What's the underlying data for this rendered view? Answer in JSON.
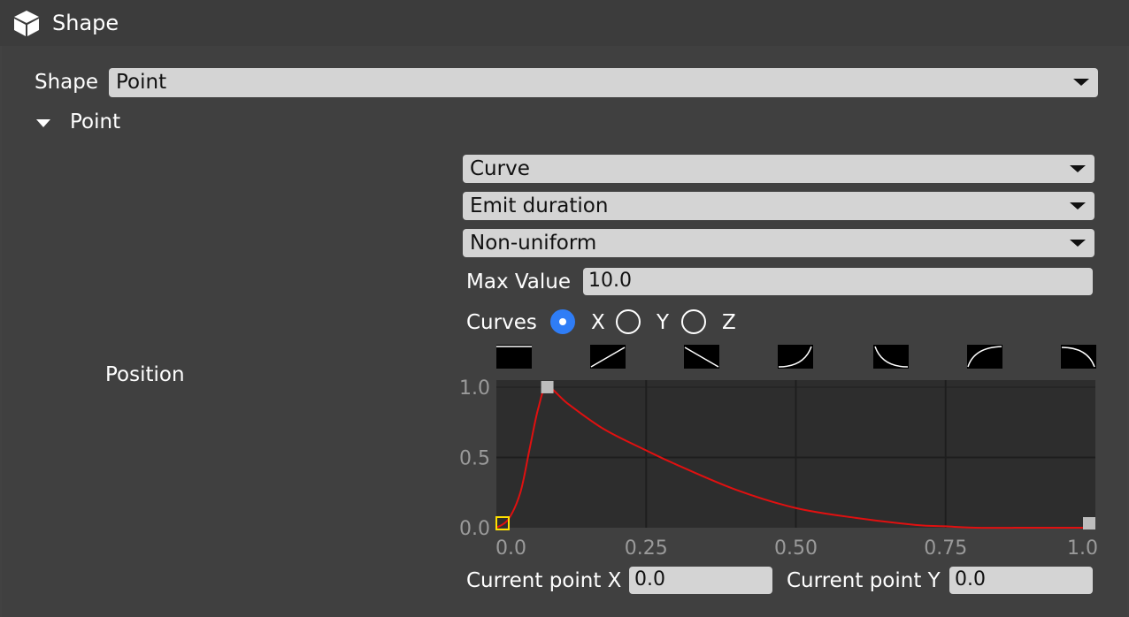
{
  "header": {
    "title": "Shape",
    "icon": "cube-icon"
  },
  "shape": {
    "label": "Shape",
    "value": "Point"
  },
  "section": {
    "label": "Point",
    "expanded": true
  },
  "position": {
    "label": "Position",
    "mode": "Curve",
    "curve_source": "Emit duration",
    "uniformity": "Non-uniform",
    "max_value_label": "Max Value",
    "max_value": "10.0",
    "curves_label": "Curves",
    "curve_options": [
      {
        "label": "X",
        "checked": true
      },
      {
        "label": "Y",
        "checked": false
      },
      {
        "label": "Z",
        "checked": false
      }
    ],
    "presets": [
      "constant",
      "linear-up",
      "linear-down",
      "ease-in",
      "ease-out-down",
      "ease-out-up",
      "ease-in-down"
    ],
    "current_x_label": "Current point X",
    "current_x": "0.0",
    "current_y_label": "Current point Y",
    "current_y": "0.0"
  },
  "colors": {
    "accent": "#2f7df6",
    "curve": "#e01010",
    "selected_point": "#ffe000"
  },
  "chart_data": {
    "type": "line",
    "x_ticks": [
      "0.0",
      "0.25",
      "0.50",
      "0.75",
      "1.0"
    ],
    "y_ticks": [
      "1.0",
      "0.5",
      "0.0"
    ],
    "xlim": [
      0,
      1
    ],
    "ylim": [
      0,
      1.05
    ],
    "grid": true,
    "control_points": [
      {
        "x": 0.0,
        "y": 0.0,
        "selected": true
      },
      {
        "x": 0.085,
        "y": 1.0,
        "selected": false
      },
      {
        "x": 1.0,
        "y": 0.0,
        "selected": false
      }
    ],
    "curve": {
      "x": [
        0.0,
        0.02,
        0.04,
        0.055,
        0.07,
        0.085,
        0.12,
        0.18,
        0.25,
        0.3,
        0.4,
        0.5,
        0.6,
        0.7,
        0.75,
        0.8,
        0.9,
        1.0
      ],
      "y": [
        0.0,
        0.06,
        0.25,
        0.55,
        0.85,
        1.0,
        0.88,
        0.7,
        0.55,
        0.45,
        0.27,
        0.14,
        0.07,
        0.02,
        0.01,
        0.0,
        0.0,
        0.0
      ]
    }
  }
}
